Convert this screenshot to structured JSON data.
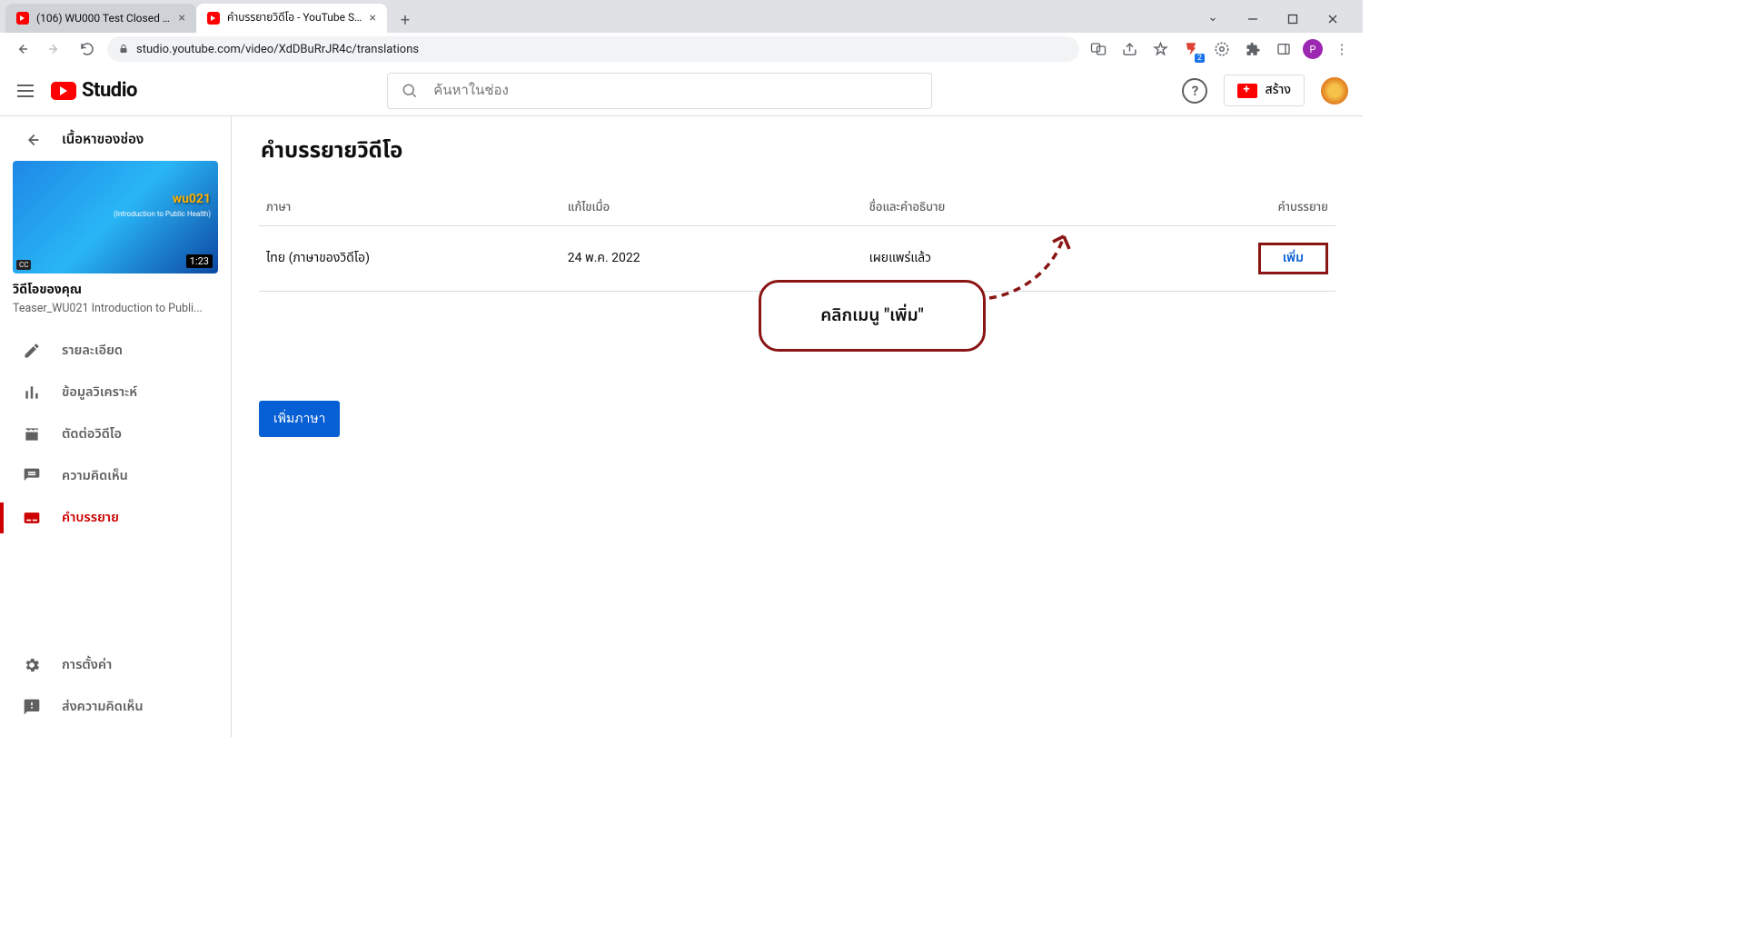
{
  "browser": {
    "tabs": [
      {
        "title": "(106) WU000 Test Closed caption",
        "active": false
      },
      {
        "title": "คำบรรยายวิดีโอ - YouTube Studio",
        "active": true
      }
    ],
    "url": "studio.youtube.com/video/XdDBuRrJR4c/translations",
    "profile_initial": "P"
  },
  "header": {
    "logo_text": "Studio",
    "search_placeholder": "ค้นหาในช่อง",
    "create_label": "สร้าง"
  },
  "sidebar": {
    "content_label": "เนื้อหาของช่อง",
    "thumbnail": {
      "duration": "1:23",
      "title_overlay": "wu021",
      "subtitle_overlay": "(Introduction to Public Health)",
      "cc": "CC"
    },
    "video_heading": "วิดีโอของคุณ",
    "video_title": "Teaser_WU021 Introduction to Publi...",
    "items": [
      {
        "label": "รายละเอียด",
        "icon": "pencil"
      },
      {
        "label": "ข้อมูลวิเคราะห์",
        "icon": "chart"
      },
      {
        "label": "ตัดต่อวิดีโอ",
        "icon": "film"
      },
      {
        "label": "ความคิดเห็น",
        "icon": "comment"
      },
      {
        "label": "คำบรรยาย",
        "icon": "subtitles",
        "active": true
      }
    ],
    "bottom": [
      {
        "label": "การตั้งค่า",
        "icon": "gear"
      },
      {
        "label": "ส่งความคิดเห็น",
        "icon": "feedback"
      }
    ]
  },
  "main": {
    "page_title": "คำบรรยายวิดีโอ",
    "columns": {
      "lang": "ภาษา",
      "modified": "แก้ไขเมื่อ",
      "title_desc": "ชื่อและคำอธิบาย",
      "subtitles": "คำบรรยาย"
    },
    "row": {
      "lang": "ไทย (ภาษาของวิดีโอ)",
      "modified": "24 พ.ค. 2022",
      "title_desc": "เผยแพร่แล้ว",
      "add_label": "เพิ่ม"
    },
    "add_language_button": "เพิ่มภาษา",
    "callout_text": "คลิกเมนู \"เพิ่ม\""
  }
}
